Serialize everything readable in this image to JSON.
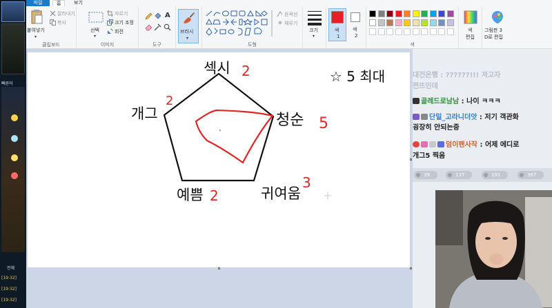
{
  "ribbon": {
    "tabs": [
      "파일",
      "홈",
      "보기"
    ],
    "clipboard": {
      "paste": "붙여넣기",
      "cut": "잘라내기",
      "copy": "복사",
      "label": "클립보드"
    },
    "image": {
      "select": "선택",
      "crop": "자르기",
      "resize": "크기 조정",
      "rotate": "회전",
      "label": "이미지"
    },
    "tools": {
      "label": "도구"
    },
    "brush": {
      "label": "브러시"
    },
    "shapes": {
      "outline": "윤곽선",
      "fill": "채우기",
      "label": "도형"
    },
    "size": {
      "label": "크기"
    },
    "color1": {
      "label": "색",
      "sub": "1"
    },
    "color2": {
      "label": "색",
      "sub": "2"
    },
    "colors": {
      "label": "색"
    },
    "edit_colors": {
      "label": "색",
      "sub": "편집"
    },
    "paint3d": {
      "label": "그림판 3",
      "sub": "D로 편집"
    }
  },
  "colors": {
    "accent": "#1979ca",
    "color1": "#ed1c24",
    "color2": "#ffffff",
    "palette": [
      "#000000",
      "#7f7f7f",
      "#880015",
      "#ed1c24",
      "#ff7f27",
      "#fff200",
      "#22b14c",
      "#00a2e8",
      "#3f48cc",
      "#a349a4",
      "#ffffff",
      "#c3c3c3",
      "#b97a57",
      "#ffaec9",
      "#ffc90e",
      "#efe4b0",
      "#b5e61d",
      "#99d9ea",
      "#7092be",
      "#c8bfe7"
    ]
  },
  "drawing": {
    "labels": [
      {
        "text": "섹시",
        "score": "2"
      },
      {
        "text": "청순",
        "score": "5"
      },
      {
        "text": "귀여움",
        "score": "3"
      },
      {
        "text": "예쁨",
        "score": "2"
      },
      {
        "text": "개그",
        "score": "2"
      }
    ],
    "corner_note": "☆ 5 최대"
  },
  "left_panel": {
    "tab": "빠른어",
    "section": "전체",
    "times": [
      "[19:32]",
      "[19:32]",
      "[19:32]"
    ]
  },
  "chat": {
    "messages": [
      {
        "name": "대전은행",
        "sep": " : ",
        "text": "??????!!! 져고자",
        "faded": true
      },
      {
        "name": "",
        "sep": "",
        "text": "쩐뜨인데",
        "faded": true
      },
      {
        "name": "골레드로남남",
        "sep": " : ",
        "text": "나이 ㅋㅋㅋ"
      },
      {
        "name": "단밀_고라니더앗",
        "sep": " : ",
        "text": "저기 객관화"
      },
      {
        "name": "",
        "sep": "",
        "text": "굉장히 안되는중"
      },
      {
        "name": "덤이팬사작",
        "sep": " : ",
        "text": "어제 에디로"
      },
      {
        "name": "",
        "sep": "",
        "text": "개그5 찍음"
      }
    ],
    "stats": [
      "39",
      "137",
      "191",
      "367"
    ]
  }
}
